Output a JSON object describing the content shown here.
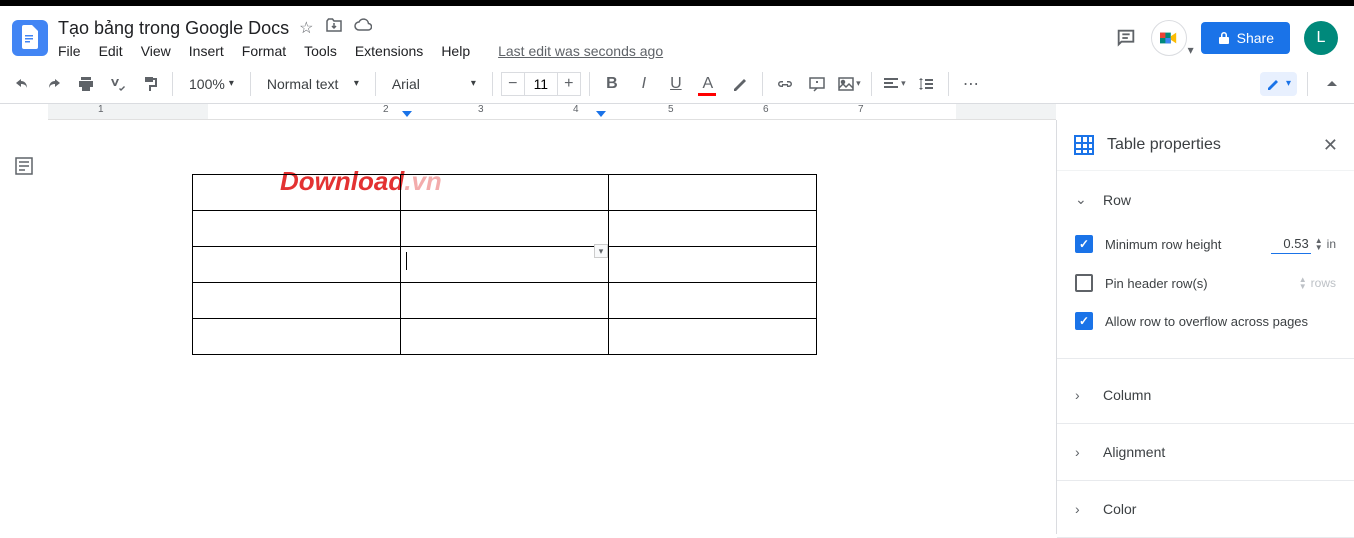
{
  "header": {
    "title": "Tạo bảng trong Google Docs",
    "menus": [
      "File",
      "Edit",
      "View",
      "Insert",
      "Format",
      "Tools",
      "Extensions",
      "Help"
    ],
    "last_edit": "Last edit was seconds ago",
    "share_label": "Share",
    "avatar_letter": "L"
  },
  "toolbar": {
    "zoom": "100%",
    "style": "Normal text",
    "font": "Arial",
    "font_size": "11"
  },
  "watermark": {
    "part1": "Download",
    "part2": ".vn"
  },
  "sidebar": {
    "title": "Table properties",
    "row": {
      "label": "Row",
      "min_height_label": "Minimum row height",
      "min_height_value": "0.53",
      "min_height_unit": "in",
      "pin_label": "Pin header row(s)",
      "pin_unit": "rows",
      "overflow_label": "Allow row to overflow across pages"
    },
    "column_label": "Column",
    "alignment_label": "Alignment",
    "color_label": "Color"
  }
}
